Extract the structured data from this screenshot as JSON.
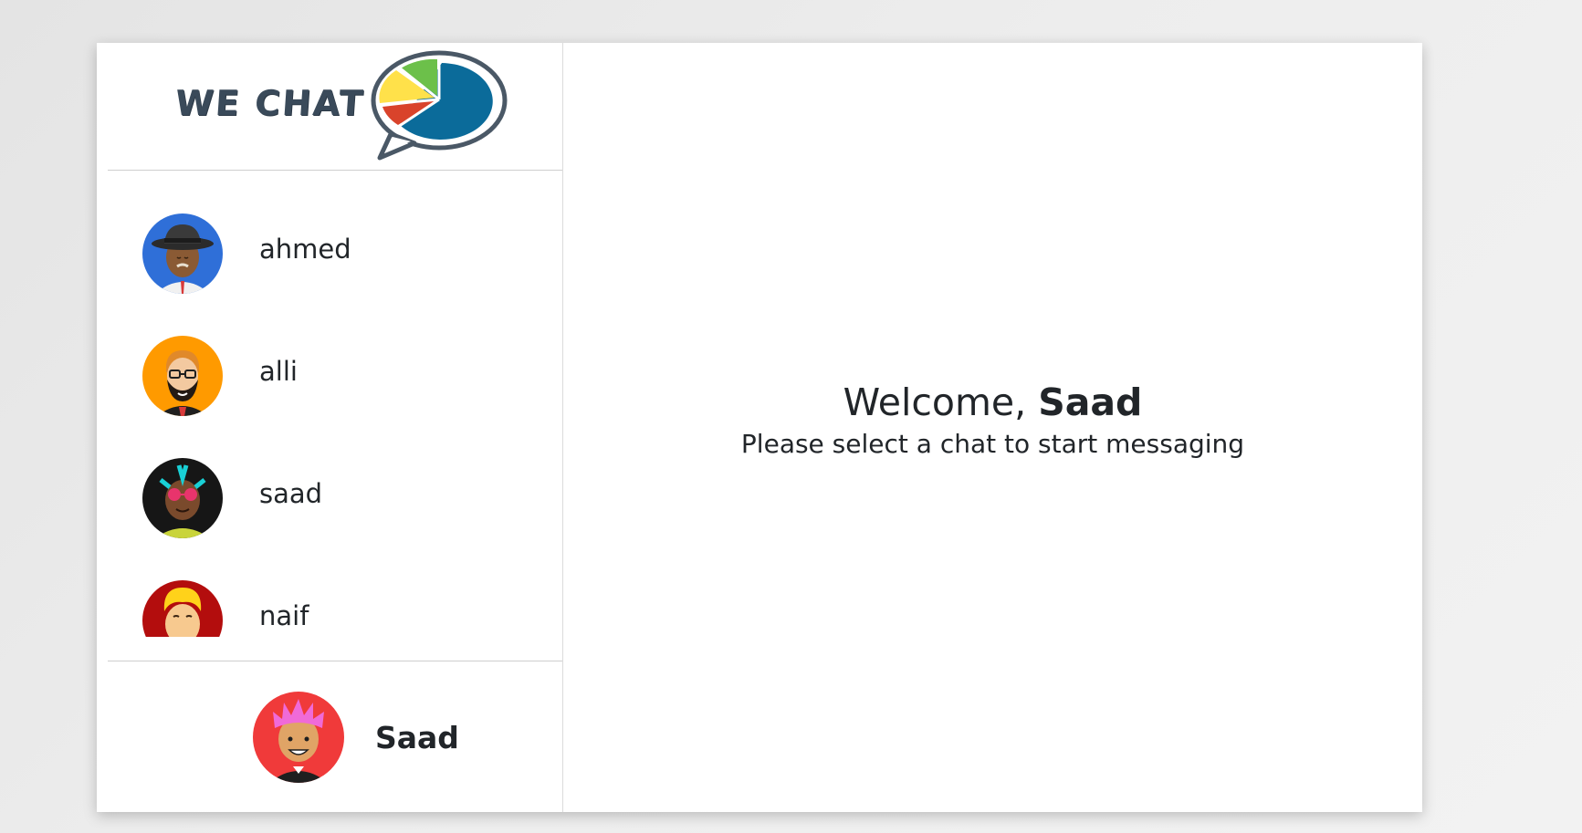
{
  "app": {
    "logo_text": "WE CHAT"
  },
  "contacts": [
    {
      "name": "ahmed",
      "avatar_icon": "man-with-fedora-avatar-icon",
      "avatar_bg": "#2f6fd8"
    },
    {
      "name": "alli",
      "avatar_icon": "bearded-man-with-glasses-avatar-icon",
      "avatar_bg": "#ff9a00"
    },
    {
      "name": "saad",
      "avatar_icon": "woman-with-sunglasses-avatar-icon",
      "avatar_bg": "#161616"
    },
    {
      "name": "naif",
      "avatar_icon": "blonde-man-avatar-icon",
      "avatar_bg": "#b30d0d"
    }
  ],
  "current_user": {
    "name": "Saad",
    "avatar_icon": "pink-haired-man-avatar-icon",
    "avatar_bg": "#f03a3a"
  },
  "main": {
    "welcome_prefix": "Welcome, ",
    "welcome_name": "Saad",
    "subtitle": "Please select a chat to start messaging"
  },
  "colors": {
    "logo_text": "#3a4a5a",
    "bubble_blue": "#0b6b9a",
    "bubble_outline": "#4a5866",
    "slice_green": "#6cc04a",
    "slice_yellow": "#ffe14a",
    "slice_red": "#d9432b"
  }
}
